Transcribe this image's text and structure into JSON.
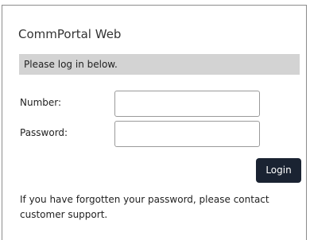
{
  "app": {
    "title": "CommPortal Web"
  },
  "login": {
    "notice": "Please log in below.",
    "number_label": "Number:",
    "number_value": "",
    "password_label": "Password:",
    "password_value": "",
    "login_button": "Login",
    "help_text": "If you have forgotten your password, please contact customer support."
  },
  "colors": {
    "notice_background": "#d3d3d3",
    "button_background": "#1a2332",
    "button_text": "#ffffff",
    "panel_border": "#8c8c8c"
  }
}
